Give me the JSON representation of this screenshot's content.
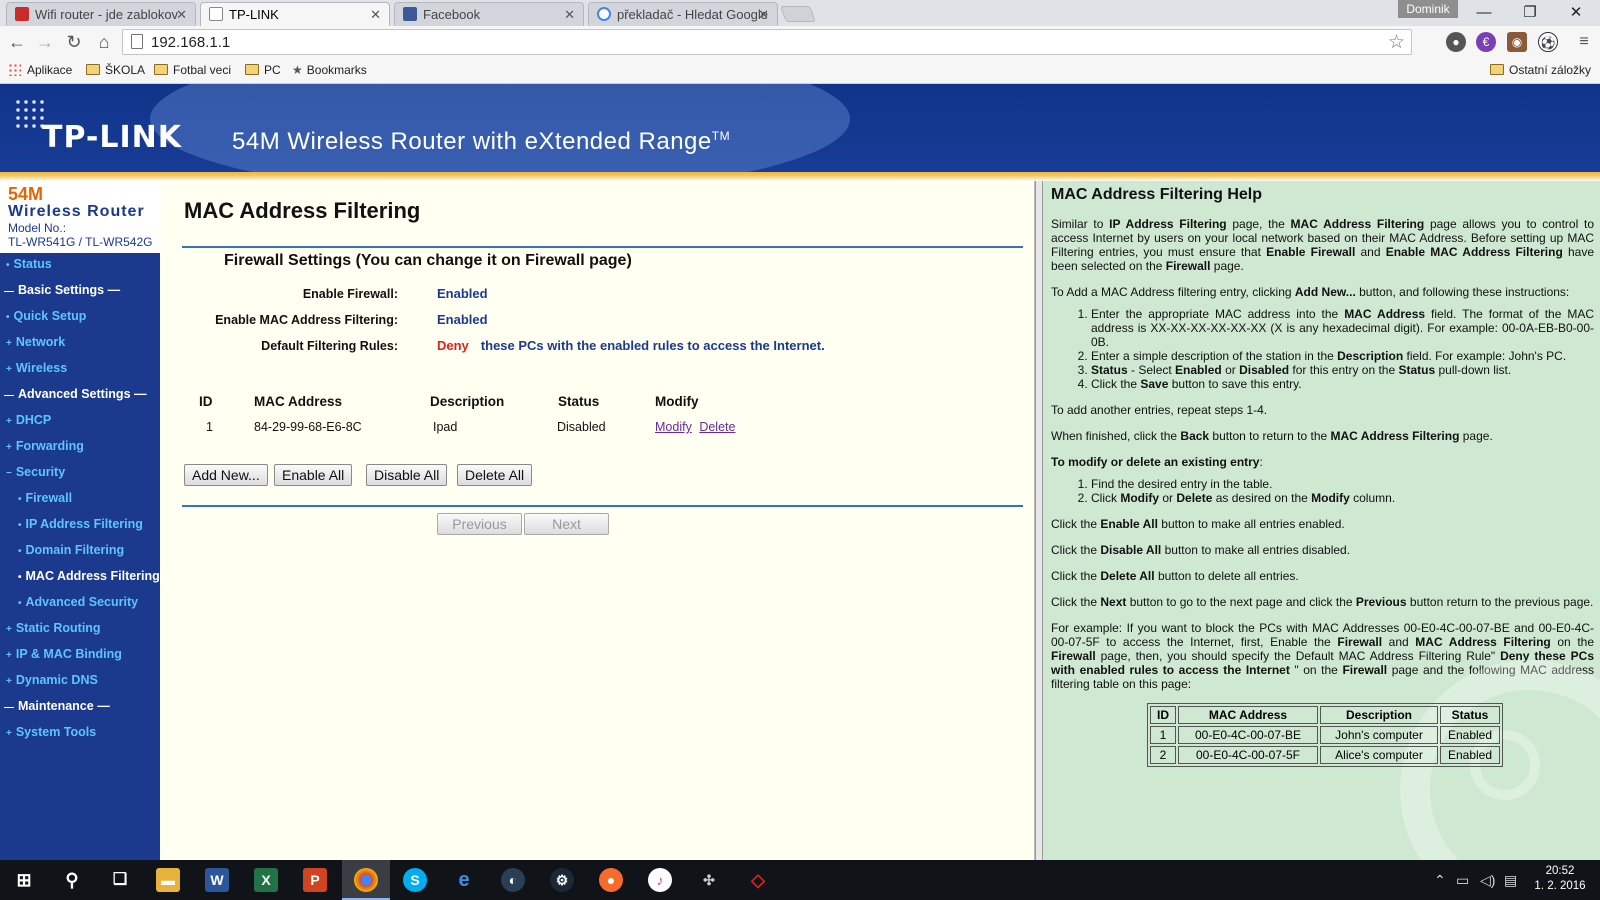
{
  "browser": {
    "tabs": [
      {
        "title": "Wifi router - jde zablokov",
        "color": "#c92a2a"
      },
      {
        "title": "TP-LINK",
        "color": "#ffffff"
      },
      {
        "title": "Facebook",
        "color": "#3b5998"
      },
      {
        "title": "překladač - Hledat Google",
        "color": "#4285f4"
      }
    ],
    "user": "Dominik",
    "url": "192.168.1.1",
    "bookmarks": [
      "Aplikace",
      "ŠKOLA",
      "Fotbal veci",
      "PC",
      "Bookmarks"
    ],
    "other_bookmarks": "Ostatní záložky"
  },
  "banner": {
    "logo": "TP-LINK",
    "tagline": "54M Wireless Router with eXtended Range",
    "tm": "TM"
  },
  "sidebar": {
    "brand_line1": "54M",
    "brand_line2": "Wireless Router",
    "model_label": "Model No.:",
    "model": "TL-WR541G / TL-WR542G",
    "items": [
      {
        "label": "Status",
        "kind": "top"
      },
      {
        "label": "Basic Settings",
        "kind": "section"
      },
      {
        "label": "Quick Setup",
        "kind": "top"
      },
      {
        "label": "Network",
        "kind": "top"
      },
      {
        "label": "Wireless",
        "kind": "top"
      },
      {
        "label": "Advanced Settings",
        "kind": "section"
      },
      {
        "label": "DHCP",
        "kind": "top"
      },
      {
        "label": "Forwarding",
        "kind": "top"
      },
      {
        "label": "Security",
        "kind": "top"
      },
      {
        "label": "Firewall",
        "kind": "sub"
      },
      {
        "label": "IP Address Filtering",
        "kind": "sub"
      },
      {
        "label": "Domain Filtering",
        "kind": "sub"
      },
      {
        "label": "MAC Address Filtering",
        "kind": "current"
      },
      {
        "label": "Advanced Security",
        "kind": "sub"
      },
      {
        "label": "Static Routing",
        "kind": "top"
      },
      {
        "label": "IP & MAC Binding",
        "kind": "top"
      },
      {
        "label": "Dynamic DNS",
        "kind": "top"
      },
      {
        "label": "Maintenance",
        "kind": "section"
      },
      {
        "label": "System Tools",
        "kind": "top"
      }
    ]
  },
  "main": {
    "title": "MAC Address Filtering",
    "firewall_title": "Firewall Settings (You can change it on Firewall page)",
    "enable_firewall_label": "Enable Firewall:",
    "enable_firewall_value": "Enabled",
    "enable_mac_label": "Enable MAC Address Filtering:",
    "enable_mac_value": "Enabled",
    "default_rules_label": "Default Filtering Rules:",
    "default_rules_action": "Deny",
    "default_rules_text": "these PCs with the enabled rules to access the Internet.",
    "columns": [
      "ID",
      "MAC Address",
      "Description",
      "Status",
      "Modify"
    ],
    "rows": [
      {
        "id": "1",
        "mac": "84-29-99-68-E6-8C",
        "description": "Ipad",
        "status": "Disabled",
        "modify": "Modify",
        "delete": "Delete"
      }
    ],
    "buttons": {
      "add_new": "Add New...",
      "enable_all": "Enable All",
      "disable_all": "Disable All",
      "delete_all": "Delete All",
      "previous": "Previous",
      "next": "Next"
    }
  },
  "help": {
    "title": "MAC Address Filtering Help",
    "example_table": {
      "columns": [
        "ID",
        "MAC Address",
        "Description",
        "Status"
      ],
      "rows": [
        [
          "1",
          "00-E0-4C-00-07-BE",
          "John's computer",
          "Enabled"
        ],
        [
          "2",
          "00-E0-4C-00-07-5F",
          "Alice's computer",
          "Enabled"
        ]
      ]
    }
  },
  "taskbar": {
    "time": "20:52",
    "date": "1. 2. 2016"
  },
  "colors": {
    "banner_blue": "#11348a",
    "menu_link": "#5ec4ff",
    "value_blue": "#1b3a8d",
    "deny_red": "#e02020",
    "help_bg": "#cfe8d2",
    "main_bg": "#fffff2"
  }
}
